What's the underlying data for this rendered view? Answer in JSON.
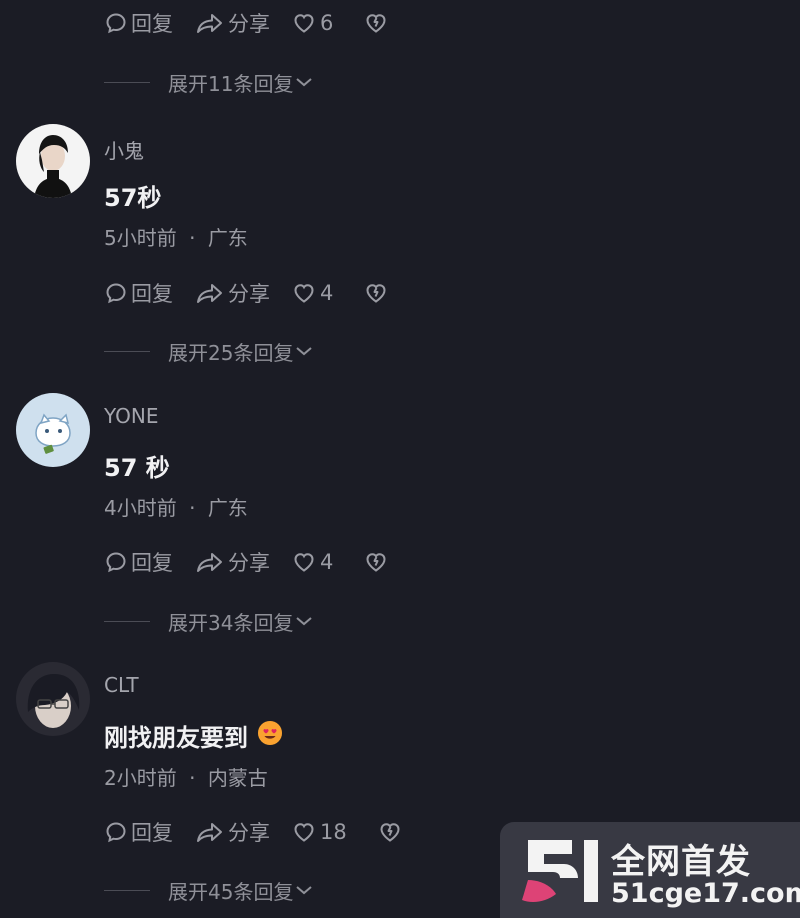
{
  "top_actions": {
    "reply": "回复",
    "share": "分享",
    "likes": "6"
  },
  "top_expand": "展开11条回复",
  "comments": [
    {
      "username": "小鬼",
      "text": "57秒",
      "time": "5小时前",
      "location": "广东",
      "reply": "回复",
      "share": "分享",
      "likes": "4",
      "expand": "展开25条回复"
    },
    {
      "username": "YONE",
      "text": "57 秒",
      "time": "4小时前",
      "location": "广东",
      "reply": "回复",
      "share": "分享",
      "likes": "4",
      "expand": "展开34条回复"
    },
    {
      "username": "CLT",
      "text": "刚找朋友要到",
      "emoji": "😍",
      "time": "2小时前",
      "location": "内蒙古",
      "reply": "回复",
      "share": "分享",
      "likes": "18",
      "expand": "展开45条回复"
    }
  ],
  "meta_separator": "·",
  "watermark": {
    "title": "全网首发",
    "url": "51cge17.com"
  },
  "colors": {
    "background": "#1b1c25",
    "muted_text": "#9a9ba3",
    "primary_text": "#f1f1f3",
    "watermark_pink": "#e8467b"
  }
}
